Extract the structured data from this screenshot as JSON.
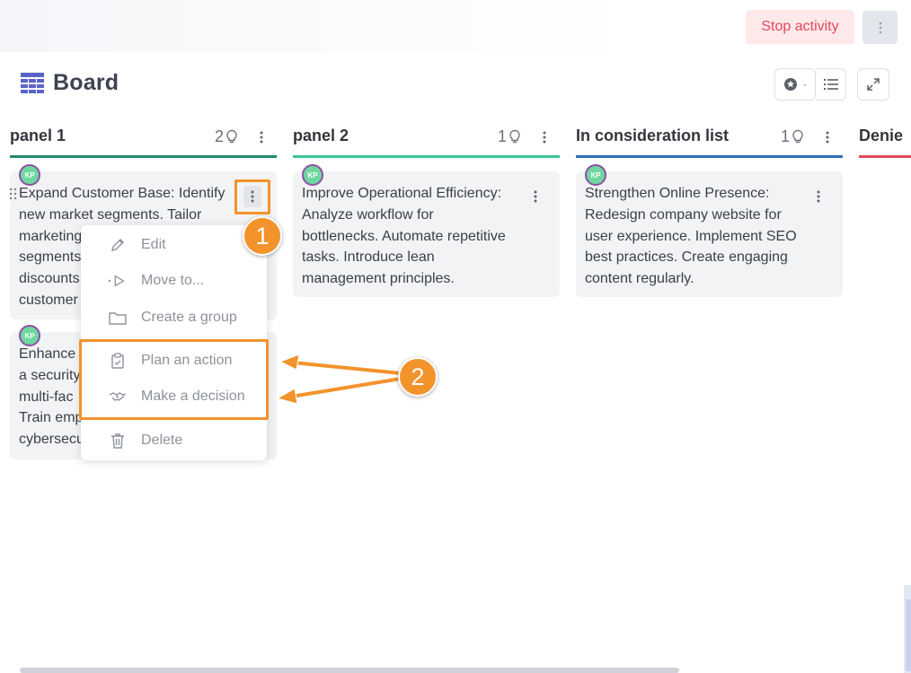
{
  "header": {
    "stop_label": "Stop activity",
    "title": "Board"
  },
  "panels": [
    {
      "name": "panel 1",
      "count": "2",
      "color": "#1f8a6e"
    },
    {
      "name": "panel 2",
      "count": "1",
      "color": "#3cc591"
    },
    {
      "name": "In consideration list",
      "count": "1",
      "color": "#2f6fb8"
    },
    {
      "name": "Denie",
      "color": "#e5485b"
    }
  ],
  "cards": [
    {
      "avatar": "KP",
      "text": "Expand Customer Base: Identify\nnew market segments. Tailor\nmarketing\nsegments\ndiscounts\ncustomer"
    },
    {
      "avatar": "KP",
      "text": "Enhance\na security\nmulti-fac\nTrain emp\ncybersecu"
    },
    {
      "avatar": "KP",
      "text": "Improve Operational Efficiency:\nAnalyze workflow for\nbottlenecks. Automate repetitive\ntasks. Introduce lean\nmanagement principles."
    },
    {
      "avatar": "KP",
      "text": "Strengthen Online Presence:\nRedesign company website for\nuser experience. Implement SEO\nbest practices. Create engaging\ncontent regularly."
    }
  ],
  "menu": {
    "items": [
      {
        "label": "Edit",
        "icon": "pencil-icon"
      },
      {
        "label": "Move to...",
        "icon": "move-icon"
      },
      {
        "label": "Create a group",
        "icon": "folder-icon"
      },
      {
        "label": "Plan an action",
        "icon": "clipboard-icon"
      },
      {
        "label": "Make a decision",
        "icon": "handshake-icon"
      },
      {
        "label": "Delete",
        "icon": "trash-icon"
      }
    ]
  },
  "annotations": {
    "badge1": "1",
    "badge2": "2"
  },
  "colors": {
    "accent": "#f2932b",
    "stop_text": "#e5485b",
    "stop_bg": "#fde8ea",
    "avatar": "#6fd7a0"
  }
}
